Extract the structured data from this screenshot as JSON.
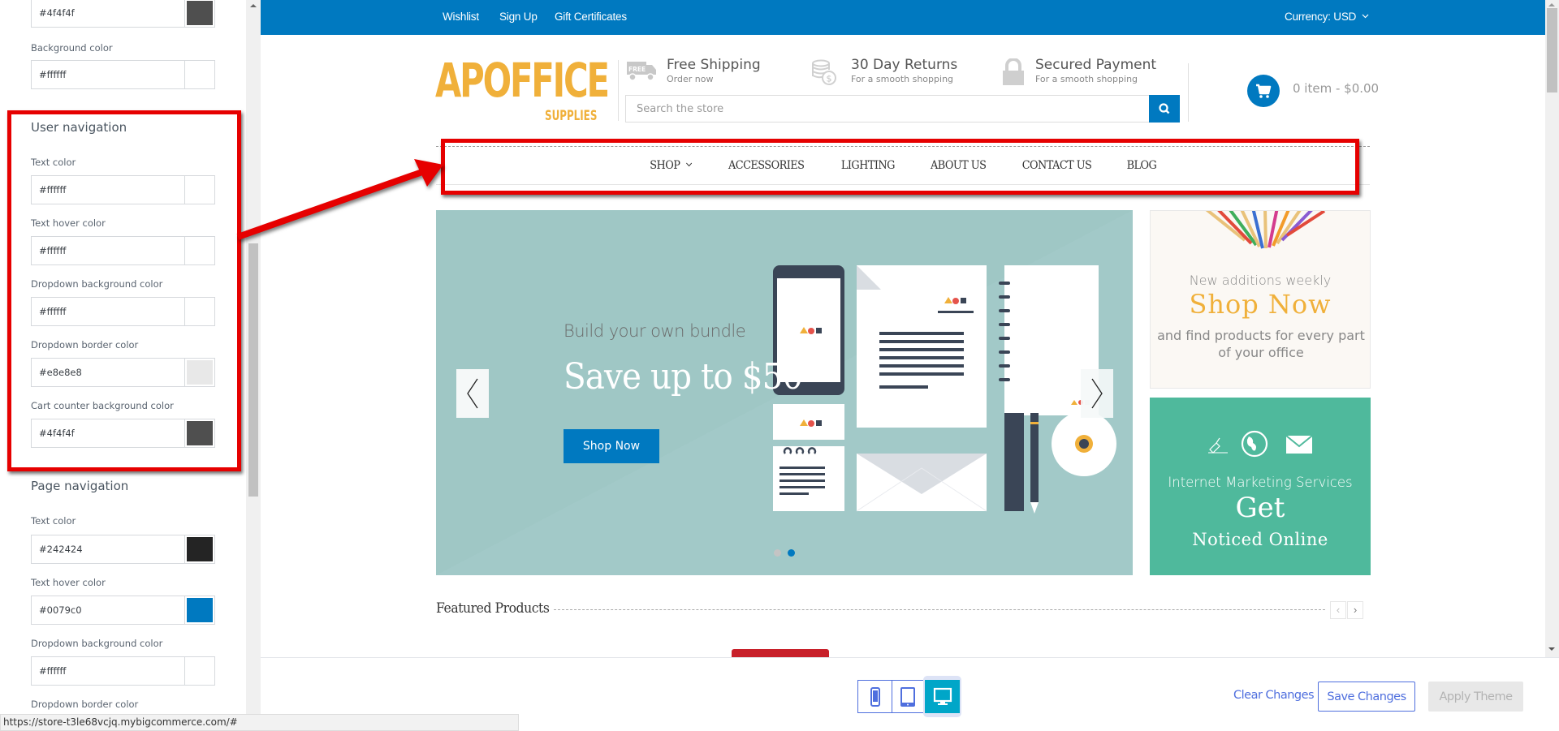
{
  "sidebar": {
    "top_field": {
      "value": "#4f4f4f",
      "swatch": "#4f4f4f"
    },
    "background": {
      "label": "Background color",
      "value": "#ffffff",
      "swatch": "#ffffff"
    },
    "user_navigation": {
      "title": "User navigation",
      "fields": [
        {
          "label": "Text color",
          "value": "#ffffff",
          "swatch": "#ffffff"
        },
        {
          "label": "Text hover color",
          "value": "#ffffff",
          "swatch": "#ffffff"
        },
        {
          "label": "Dropdown background color",
          "value": "#ffffff",
          "swatch": "#ffffff"
        },
        {
          "label": "Dropdown border color",
          "value": "#e8e8e8",
          "swatch": "#e8e8e8"
        },
        {
          "label": "Cart counter background color",
          "value": "#4f4f4f",
          "swatch": "#4f4f4f"
        }
      ]
    },
    "page_navigation": {
      "title": "Page navigation",
      "fields": [
        {
          "label": "Text color",
          "value": "#242424",
          "swatch": "#242424"
        },
        {
          "label": "Text hover color",
          "value": "#0079c0",
          "swatch": "#0079c0"
        },
        {
          "label": "Dropdown background color",
          "value": "#ffffff",
          "swatch": "#ffffff"
        },
        {
          "label": "Dropdown border color"
        }
      ]
    }
  },
  "store": {
    "topbar": {
      "links": [
        "Wishlist",
        "Sign Up",
        "Gift Certificates"
      ],
      "currency": "Currency: USD"
    },
    "logo": {
      "main": "APOFFICE",
      "sub": "SUPPLIES"
    },
    "features": [
      {
        "icon": "free-truck-icon",
        "title": "Free Shipping",
        "subtitle": "Order now",
        "badge": "FREE"
      },
      {
        "icon": "coins-icon",
        "title": "30 Day Returns",
        "subtitle": "For a smooth shopping"
      },
      {
        "icon": "lock-icon",
        "title": "Secured Payment",
        "subtitle": "For a smooth shopping"
      }
    ],
    "search": {
      "placeholder": "Search the store"
    },
    "cart": {
      "text": "0 item - $0.00"
    },
    "nav": [
      "SHOP",
      "ACCESSORIES",
      "LIGHTING",
      "ABOUT US",
      "CONTACT US",
      "BLOG"
    ],
    "hero": {
      "subtitle": "Build your own bundle",
      "title": "Save up to $50",
      "button": "Shop Now",
      "slide_count": 2,
      "active_slide": 2
    },
    "banner1": {
      "line1": "New additions weekly",
      "headline": "Shop Now",
      "line2": "and find products for every part of your office"
    },
    "banner2": {
      "line1": "Internet Marketing Services",
      "headline": "Get",
      "line2": "Noticed Online"
    },
    "featured": {
      "title": "Featured Products",
      "prev": "‹",
      "next": "›"
    }
  },
  "toolbar": {
    "devices": [
      "mobile",
      "tablet",
      "desktop"
    ],
    "active_device": "desktop",
    "clear": "Clear Changes",
    "save": "Save Changes",
    "apply": "Apply Theme"
  },
  "status_url": "https://store-t3le68vcjq.mybigcommerce.com/#",
  "colors": {
    "brand_blue": "#0079c0",
    "logo_orange": "#f0b03a",
    "hero_bg": "#9fc7c5",
    "banner_green": "#4fb99c",
    "annotation_red": "#e60000"
  }
}
